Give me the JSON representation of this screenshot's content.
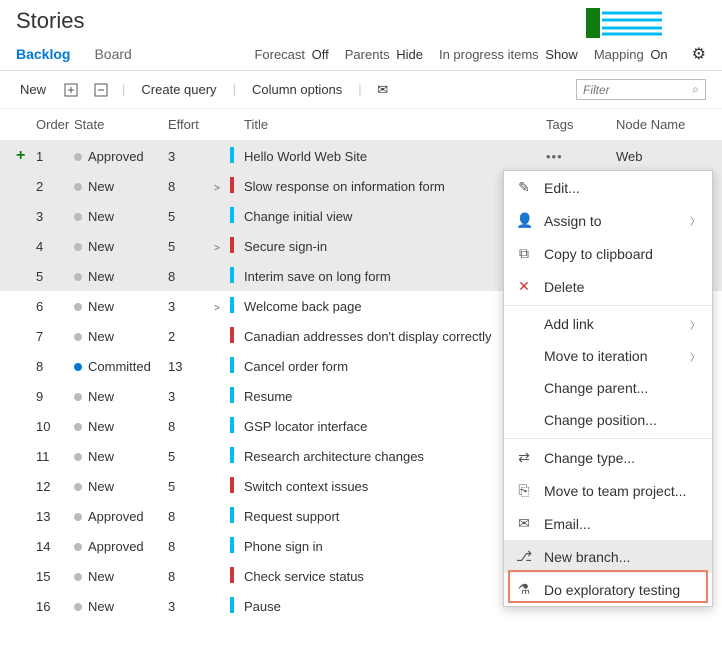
{
  "header": {
    "title": "Stories"
  },
  "tabs": {
    "backlog": "Backlog",
    "board": "Board"
  },
  "options": {
    "forecast": {
      "label": "Forecast",
      "value": "Off"
    },
    "parents": {
      "label": "Parents",
      "value": "Hide"
    },
    "inprogress": {
      "label": "In progress items",
      "value": "Show"
    },
    "mapping": {
      "label": "Mapping",
      "value": "On"
    }
  },
  "toolbar": {
    "new": "New",
    "create_query": "Create query",
    "column_options": "Column options"
  },
  "filter": {
    "placeholder": "Filter"
  },
  "columns": {
    "order": "Order",
    "state": "State",
    "effort": "Effort",
    "title": "Title",
    "tags": "Tags",
    "node": "Node Name"
  },
  "rows": [
    {
      "order": "1",
      "state": "Approved",
      "dot": "grey",
      "effort": "3",
      "expand": "",
      "color": "teal",
      "title": "Hello World Web Site",
      "node": "Web",
      "sel": true,
      "add": true,
      "ellipsis": true
    },
    {
      "order": "2",
      "state": "New",
      "dot": "grey",
      "effort": "8",
      "expand": ">",
      "color": "red",
      "title": "Slow response on information form",
      "node": "",
      "sel": true
    },
    {
      "order": "3",
      "state": "New",
      "dot": "grey",
      "effort": "5",
      "expand": "",
      "color": "teal",
      "title": "Change initial view",
      "node": "",
      "sel": true
    },
    {
      "order": "4",
      "state": "New",
      "dot": "grey",
      "effort": "5",
      "expand": ">",
      "color": "red",
      "title": "Secure sign-in",
      "node": "",
      "sel": true
    },
    {
      "order": "5",
      "state": "New",
      "dot": "grey",
      "effort": "8",
      "expand": "",
      "color": "teal",
      "title": "Interim save on long form",
      "node": "",
      "sel": true
    },
    {
      "order": "6",
      "state": "New",
      "dot": "grey",
      "effort": "3",
      "expand": ">",
      "color": "teal",
      "title": "Welcome back page",
      "node": ""
    },
    {
      "order": "7",
      "state": "New",
      "dot": "grey",
      "effort": "2",
      "expand": "",
      "color": "red",
      "title": "Canadian addresses don't display correctly",
      "node": ""
    },
    {
      "order": "8",
      "state": "Committed",
      "dot": "blue",
      "effort": "13",
      "expand": "",
      "color": "teal",
      "title": "Cancel order form",
      "node": ""
    },
    {
      "order": "9",
      "state": "New",
      "dot": "grey",
      "effort": "3",
      "expand": "",
      "color": "teal",
      "title": "Resume",
      "node": ""
    },
    {
      "order": "10",
      "state": "New",
      "dot": "grey",
      "effort": "8",
      "expand": "",
      "color": "teal",
      "title": "GSP locator interface",
      "node": ""
    },
    {
      "order": "11",
      "state": "New",
      "dot": "grey",
      "effort": "5",
      "expand": "",
      "color": "teal",
      "title": "Research architecture changes",
      "node": ""
    },
    {
      "order": "12",
      "state": "New",
      "dot": "grey",
      "effort": "5",
      "expand": "",
      "color": "red",
      "title": "Switch context issues",
      "node": ""
    },
    {
      "order": "13",
      "state": "Approved",
      "dot": "grey",
      "effort": "8",
      "expand": "",
      "color": "teal",
      "title": "Request support",
      "node": ""
    },
    {
      "order": "14",
      "state": "Approved",
      "dot": "grey",
      "effort": "8",
      "expand": "",
      "color": "teal",
      "title": "Phone sign in",
      "node": ""
    },
    {
      "order": "15",
      "state": "New",
      "dot": "grey",
      "effort": "8",
      "expand": "",
      "color": "red",
      "title": "Check service status",
      "node": ""
    },
    {
      "order": "16",
      "state": "New",
      "dot": "grey",
      "effort": "3",
      "expand": "",
      "color": "teal",
      "title": "Pause",
      "node": ""
    }
  ],
  "context_menu": [
    {
      "icon": "✎",
      "label": "Edit..."
    },
    {
      "icon": "👤",
      "label": "Assign to",
      "sub": true
    },
    {
      "icon": "⧉",
      "label": "Copy to clipboard"
    },
    {
      "icon": "✕",
      "label": "Delete",
      "red": true
    },
    {
      "sep": true
    },
    {
      "icon": "",
      "label": "Add link",
      "sub": true
    },
    {
      "icon": "",
      "label": "Move to iteration",
      "sub": true
    },
    {
      "icon": "",
      "label": "Change parent..."
    },
    {
      "icon": "",
      "label": "Change position..."
    },
    {
      "sep": true
    },
    {
      "icon": "⇄",
      "label": "Change type..."
    },
    {
      "icon": "⎘",
      "label": "Move to team project..."
    },
    {
      "icon": "✉",
      "label": "Email..."
    },
    {
      "icon": "⎇",
      "label": "New branch...",
      "hl": true
    },
    {
      "icon": "⚗",
      "label": "Do exploratory testing"
    }
  ]
}
